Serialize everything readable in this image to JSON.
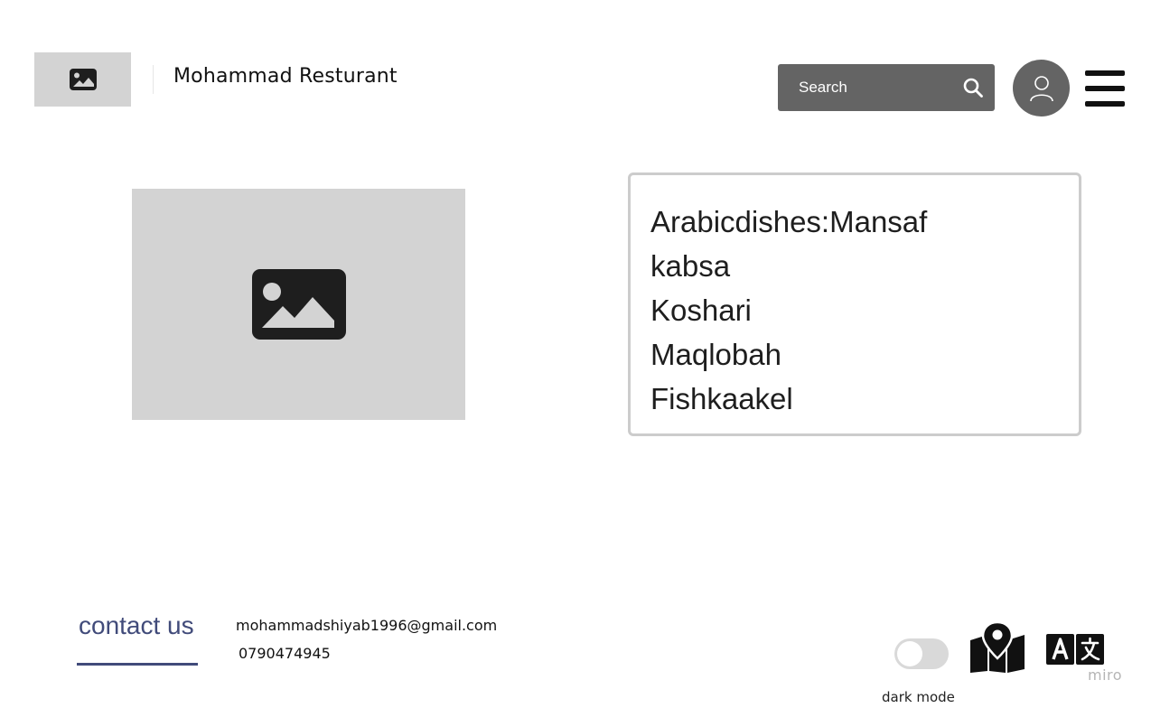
{
  "header": {
    "brand_name": "Mohammad Resturant",
    "search_placeholder": "Search"
  },
  "icons": {
    "logo": "image-icon",
    "search": "search-icon",
    "avatar": "user-icon",
    "menu": "hamburger-menu-icon",
    "hero": "image-icon",
    "map": "map-pin-icon",
    "translate": "translate-icon"
  },
  "main": {
    "menu_items": [
      "Arabicdishes:Mansaf",
      "kabsa",
      "Koshari",
      "Maqlobah",
      "Fishkaakel"
    ]
  },
  "footer": {
    "contact_title": "contact us",
    "email": "mohammadshiyab1996@gmail.com",
    "phone": "0790474945",
    "dark_mode_label": "dark mode",
    "dark_mode_on": false,
    "watermark": "miro"
  },
  "colors": {
    "placeholder_gray": "#d3d3d3",
    "dark_gray": "#646464",
    "contact_accent": "#414b7a",
    "card_border": "#cccccc"
  }
}
